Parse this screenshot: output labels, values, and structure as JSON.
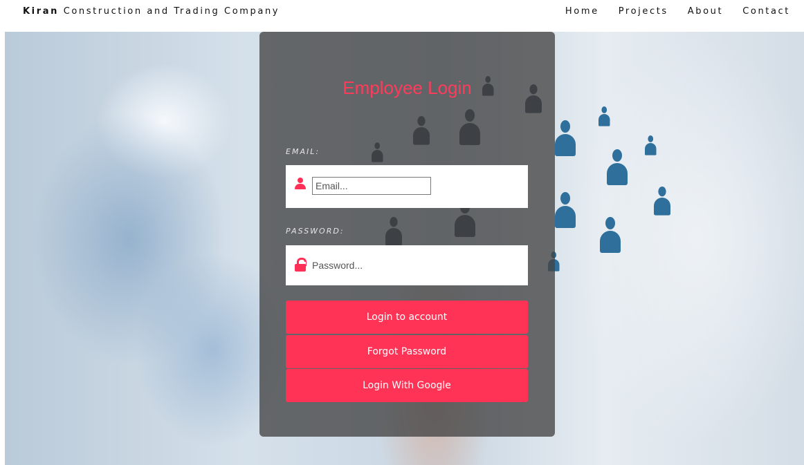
{
  "navbar": {
    "brand_bold": "Kiran",
    "brand_rest": "Construction and Trading Company",
    "links": [
      "Home",
      "Projects",
      "About",
      "Contact"
    ]
  },
  "login": {
    "title": "Employee Login",
    "email_label": "EMAIL:",
    "email_placeholder": "Email...",
    "password_label": "PASSWORD:",
    "password_placeholder": "Password...",
    "login_button": "Login to account",
    "forgot_button": "Forgot Password",
    "google_button": "Login With Google"
  },
  "icons": {
    "email_field": "user-icon",
    "password_field": "unlock-icon"
  },
  "colors": {
    "accent": "#ff3355",
    "card_overlay": "#444444",
    "nav_text": "#111111"
  }
}
